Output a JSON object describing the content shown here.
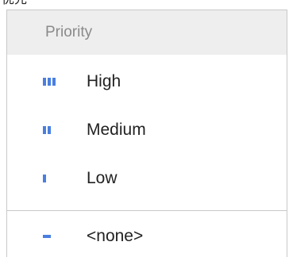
{
  "top_cutoff_label": "优先",
  "menu": {
    "header": "Priority",
    "items": [
      {
        "label": "High",
        "icon": "priority-high-icon",
        "bars": 3
      },
      {
        "label": "Medium",
        "icon": "priority-medium-icon",
        "bars": 2
      },
      {
        "label": "Low",
        "icon": "priority-low-icon",
        "bars": 1
      }
    ],
    "none_item": {
      "label": "<none>",
      "icon": "priority-none-icon"
    }
  },
  "colors": {
    "accent": "#4a7fe0",
    "header_bg": "#eeeeee",
    "border": "#c9c9c9"
  }
}
